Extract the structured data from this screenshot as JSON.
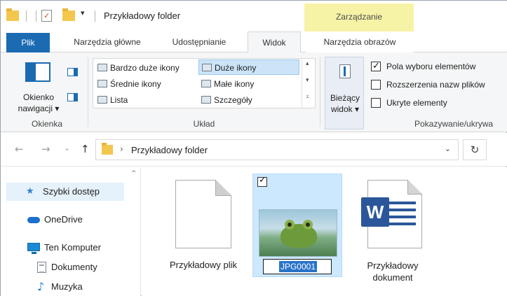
{
  "titlebar": {
    "title": "Przykładowy folder",
    "context_tab_group": "Zarządzanie",
    "dropdown_glyph": "▾"
  },
  "tabs": [
    {
      "label": "Plik"
    },
    {
      "label": "Narzędzia główne"
    },
    {
      "label": "Udostępnianie"
    },
    {
      "label": "Widok"
    },
    {
      "label": "Narzędzia obrazów"
    }
  ],
  "ribbon": {
    "panes_group": {
      "nav_pane_label_1": "Okienko",
      "nav_pane_label_2": "nawigacji ▾",
      "group_label": "Okienka"
    },
    "layout_group": {
      "items": [
        {
          "label": "Bardzo duże ikony"
        },
        {
          "label": "Średnie ikony"
        },
        {
          "label": "Lista"
        },
        {
          "label": "Duże ikony"
        },
        {
          "label": "Małe ikony"
        },
        {
          "label": "Szczegóły"
        }
      ],
      "selected": "Duże ikony",
      "group_label": "Układ"
    },
    "current_view": {
      "label_1": "Bieżący",
      "label_2": "widok ▾"
    },
    "show_hide": {
      "checkboxes": [
        {
          "label": "Pola wyboru elementów",
          "checked": true
        },
        {
          "label": "Rozszerzenia nazw plików",
          "checked": false
        },
        {
          "label": "Ukryte elementy",
          "checked": false
        }
      ],
      "group_label": "Pokazywanie/ukrywa"
    }
  },
  "address": {
    "path": "Przykładowy folder",
    "back": "←",
    "forward": "→",
    "recent": "⌄",
    "up": "↑",
    "dropdown": "⌄",
    "refresh": "↻"
  },
  "nav": {
    "items": [
      {
        "label": "Szybki dostęp",
        "icon": "star-icon"
      },
      {
        "label": "OneDrive",
        "icon": "cloud-icon"
      },
      {
        "label": "Ten Komputer",
        "icon": "computer-icon"
      },
      {
        "label": "Dokumenty",
        "icon": "document-icon"
      },
      {
        "label": "Muzyka",
        "icon": "music-icon"
      }
    ],
    "scroll_up": "^"
  },
  "files": [
    {
      "name": "Przykładowy plik",
      "type": "text"
    },
    {
      "name": "JPG0001",
      "type": "image",
      "selected": true,
      "renaming": true
    },
    {
      "name_line_1": "Przykładowy",
      "name_line_2": "dokument",
      "type": "word"
    }
  ],
  "colors": {
    "accent": "#1b6bb3",
    "selection": "#cce8ff",
    "context_tab": "#f7f3a6",
    "word_blue": "#2b579a"
  }
}
